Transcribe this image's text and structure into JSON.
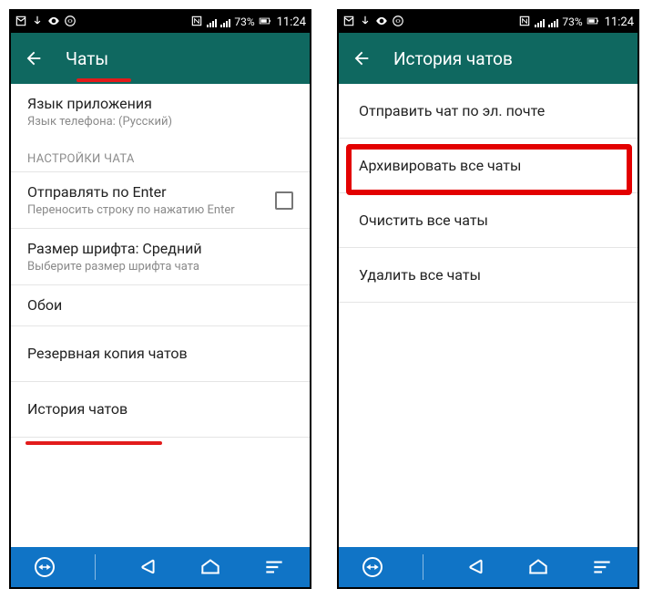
{
  "status": {
    "battery_text": "73%",
    "time": "11:24"
  },
  "screen_left": {
    "title": "Чаты",
    "lang_title": "Язык приложения",
    "lang_sub": "Язык телефона: (Русский)",
    "section_chat_settings": "НАСТРОЙКИ ЧАТА",
    "enter_title": "Отправлять по Enter",
    "enter_sub": "Переносить строку по нажатию Enter",
    "font_title": "Размер шрифта: Средний",
    "font_sub": "Выберите размер шрифта чата",
    "wallpaper": "Обои",
    "backup": "Резервная копия чатов",
    "history": "История чатов"
  },
  "screen_right": {
    "title": "История чатов",
    "email_chat": "Отправить чат по эл. почте",
    "archive_all": "Архивировать все чаты",
    "clear_all": "Очистить все чаты",
    "delete_all": "Удалить все чаты"
  }
}
